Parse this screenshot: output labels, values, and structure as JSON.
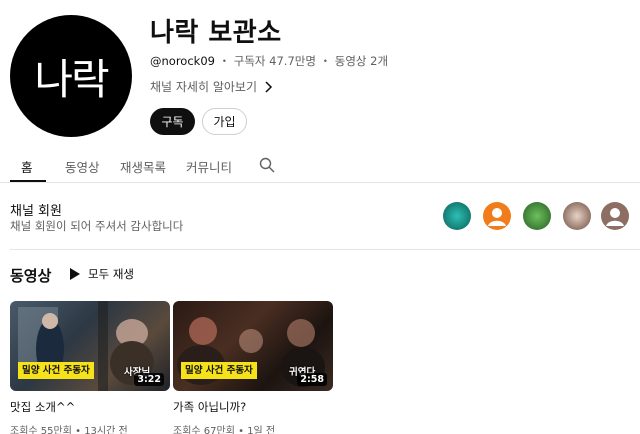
{
  "channel": {
    "avatar_text": "나락",
    "title": "나락 보관소",
    "handle": "@norock09",
    "subscribers": "구독자 47.7만명",
    "video_count": "동영상 2개",
    "separator": "・",
    "more_link": "채널 자세히 알아보기",
    "subscribe_label": "구독",
    "join_label": "가입"
  },
  "tabs": [
    {
      "label": "홈",
      "active": true
    },
    {
      "label": "동영상",
      "active": false
    },
    {
      "label": "재생목록",
      "active": false
    },
    {
      "label": "커뮤니티",
      "active": false
    }
  ],
  "membership": {
    "title": "채널 회원",
    "description": "채널 회원이 되어 주셔서 감사합니다",
    "avatars": [
      {
        "icon": "member-avatar-teal",
        "color": "#1fa39a"
      },
      {
        "icon": "person-icon",
        "color": "#f07c1b"
      },
      {
        "icon": "member-avatar-green",
        "color": "#4f9a45"
      },
      {
        "icon": "member-avatar-blurred",
        "color": "#c9a99a"
      },
      {
        "icon": "person-icon",
        "color": "#8d6e63"
      }
    ]
  },
  "videos_section": {
    "title": "동영상",
    "play_all": "모두 재생",
    "videos": [
      {
        "title": "맛집 소개^^",
        "views": "조회수 55만회",
        "age": "13시간 전",
        "duration": "3:22",
        "caption": "밀양 사건 주동자",
        "caption2": "사장님",
        "bg": "#3a4a5a"
      },
      {
        "title": "가족 아닙니까?",
        "views": "조회수 67만회",
        "age": "1일 전",
        "duration": "2:58",
        "caption": "밀양 사건 주동자",
        "caption2": "귀엽다",
        "bg": "#3a2a22"
      }
    ]
  }
}
